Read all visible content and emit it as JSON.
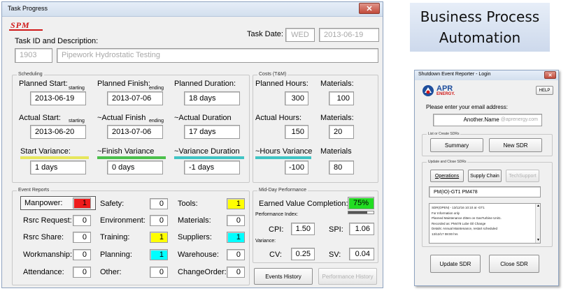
{
  "task_window": {
    "title": "Task Progress",
    "logo_text": "SPM",
    "task_date_label": "Task Date:",
    "task_day": "WED",
    "task_date": "2013-06-19",
    "task_id_label": "Task ID and Description:",
    "task_id": "1903",
    "task_description": "Pipework  Hydrostatic Testing",
    "scheduling": {
      "title": "Scheduling",
      "planned_start_label": "Planned Start:",
      "planned_start_sub": "starting",
      "planned_start": "2013-06-19",
      "planned_finish_label": "Planned Finish:",
      "planned_finish_sub": "ending",
      "planned_finish": "2013-07-06",
      "planned_duration_label": "Planned Duration:",
      "planned_duration": "18 days",
      "actual_start_label": "Actual Start:",
      "actual_start_sub": "starting",
      "actual_start": "2013-06-20",
      "actual_finish_label": "~Actual Finish",
      "actual_finish_sub": "ending",
      "actual_finish": "2013-07-06",
      "actual_duration_label": "~Actual Duration",
      "actual_duration": "17 days",
      "start_variance_label": "Start Variance:",
      "start_variance": "1 days",
      "finish_variance_label": "~Finish Variance",
      "finish_variance": "0 days",
      "variance_duration_label": "~Variance Duration",
      "variance_duration": "-1 days"
    },
    "costs": {
      "title": "Costs (T&M)",
      "planned_hours_label": "Planned Hours:",
      "planned_hours": "300",
      "materials1_label": "Materials:",
      "materials1": "100",
      "actual_hours_label": "Actual Hours:",
      "actual_hours": "150",
      "materials2_label": "Materials:",
      "materials2": "20",
      "hours_variance_label": "~Hours Variance",
      "hours_variance": "-100",
      "materials3_label": "Materials",
      "materials3": "80"
    },
    "event_reports": {
      "title": "Event Reports",
      "manpower_label": "Manpower:",
      "manpower": "1",
      "rsrc_request_label": "Rsrc Request:",
      "rsrc_request": "0",
      "rsrc_share_label": "Rsrc Share:",
      "rsrc_share": "0",
      "workmanship_label": "Workmanship:",
      "workmanship": "0",
      "attendance_label": "Attendance:",
      "attendance": "0",
      "safety_label": "Safety:",
      "safety": "0",
      "environment_label": "Environment:",
      "environment": "0",
      "training_label": "Training:",
      "training": "1",
      "planning_label": "Planning:",
      "planning": "1",
      "other_label": "Other:",
      "other": "0",
      "tools_label": "Tools:",
      "tools": "1",
      "materials_label": "Materials:",
      "materials": "0",
      "suppliers_label": "Suppliers:",
      "suppliers": "1",
      "warehouse_label": "Warehouse:",
      "warehouse": "0",
      "changeorder_label": "ChangeOrder:",
      "changeorder": "0"
    },
    "midday": {
      "title": "Mid-Day Performance",
      "evc_label": "Earned Value Completion:",
      "evc": "75%",
      "evc_progress": 0.75,
      "performance_index_label": "Performance Index:",
      "cpi_label": "CPI:",
      "cpi": "1.50",
      "spi_label": "SPI:",
      "spi": "1.06",
      "variance_label": "Variance:",
      "cv_label": "CV:",
      "cv": "0.25",
      "sv_label": "SV:",
      "sv": "0.04"
    },
    "events_history_button": "Events History",
    "performance_history_button": "Performance History"
  },
  "banner": {
    "line1": "Business Process",
    "line2": "Automation"
  },
  "shutdown_window": {
    "title": "Shutdown Event Reporter - Login",
    "logo_text": "APR",
    "logo_subtext": "ENERGY.",
    "help_button": "HELP",
    "email_prompt": "Please enter your email address:",
    "email_value": "Another.Name",
    "email_domain": "@aprenergy.com",
    "list_create_title": "List or Create SDRs",
    "summary_button": "Summary",
    "new_sdr_button": "New SDR",
    "update_close_title": "Update and Close SDRs",
    "operations_button": "Operations",
    "supply_chain_button": "Supply Chain",
    "techsupport_button": "TechSupport",
    "selected_sdr": "PM(IO)-GT1 PM478",
    "sdr_detail_lines": [
      "SDR(OPEN)  -  13/12/16 10:10 at  -GT1",
      "For Information only",
      "Planned Maintenance Zitten on GasTurbine Unit1.",
      "Recorded as:  PM478  Lube Oil Change",
      "Details: Annual Maintenance, restart scheduled",
      "13/12/17 08:00 hrs"
    ],
    "update_sdr_button": "Update SDR",
    "close_sdr_button": "Close SDR"
  },
  "colors": {
    "window_bg": "#f0f0f0",
    "titlebar": "#d9e4f1",
    "close_red": "#c75050",
    "alert_red": "#ee1c1c",
    "alert_yellow": "#ffff00",
    "alert_cyan": "#00ffff",
    "evc_green": "#22dd22",
    "start_var_underline": "#e6e65c",
    "finish_var_underline": "#4cc04c",
    "duration_var_underline": "#40c4c4",
    "hours_var_underline": "#40c4c4",
    "banner_bg": "#d5e0f0",
    "apr_blue": "#1f4e9c",
    "spm_red": "#d01818"
  }
}
